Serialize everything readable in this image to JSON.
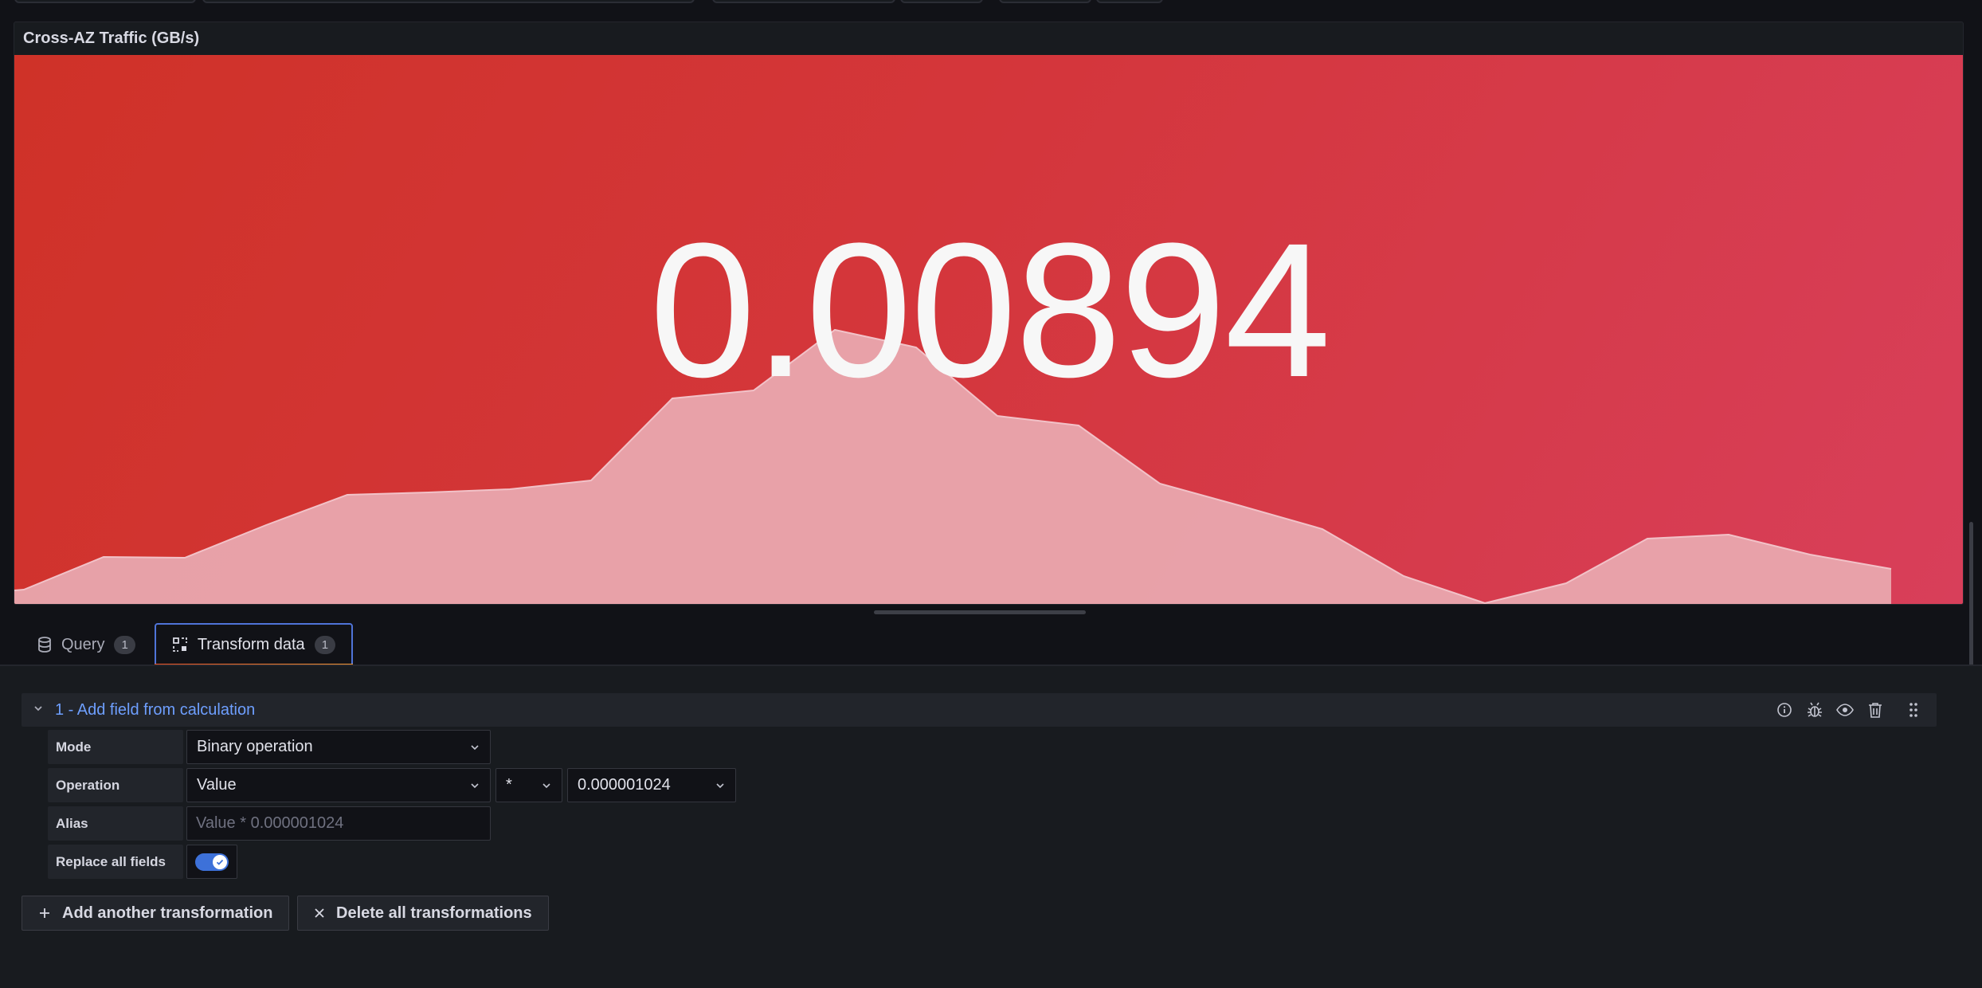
{
  "panel": {
    "title": "Cross-AZ Traffic (GB/s)",
    "stat_value": "0.00894",
    "background_colors": [
      "#cf3228",
      "#d83f5a"
    ],
    "sparkline_fill": "#e8a5ad"
  },
  "tabs": [
    {
      "label": "Query",
      "count": "1",
      "icon": "database-icon",
      "active": false
    },
    {
      "label": "Transform data",
      "count": "1",
      "icon": "transform-icon",
      "active": true
    }
  ],
  "transformation": {
    "title": "1 - Add field from calculation",
    "actions": [
      "info-icon",
      "debug-icon",
      "eye-icon",
      "trash-icon",
      "drag-handle-icon"
    ],
    "mode": {
      "label": "Mode",
      "value": "Binary operation"
    },
    "operation": {
      "label": "Operation",
      "left": "Value",
      "operator": "*",
      "right": "0.000001024"
    },
    "alias": {
      "label": "Alias",
      "placeholder": "Value * 0.000001024"
    },
    "replace_all": {
      "label": "Replace all fields",
      "enabled": true
    }
  },
  "buttons": {
    "add": "Add another transformation",
    "delete": "Delete all transformations"
  },
  "accent_color": "#6e9fff"
}
